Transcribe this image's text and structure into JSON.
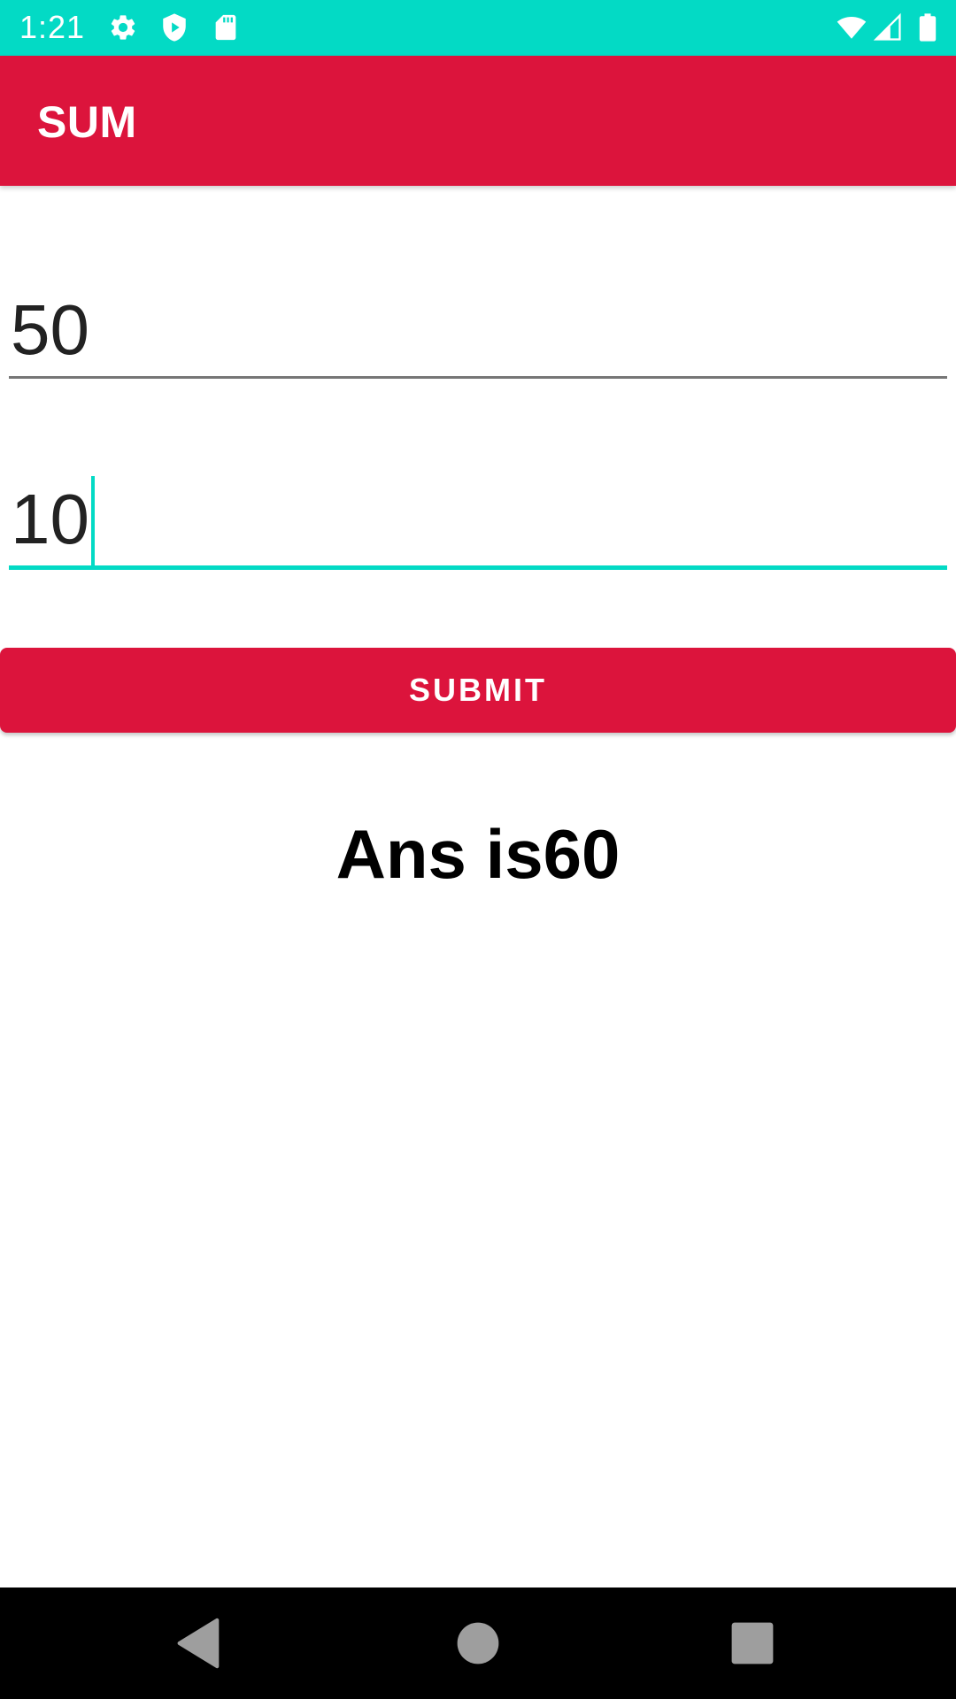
{
  "status_bar": {
    "time": "1:21",
    "left_icons": [
      "gear-icon",
      "shield-icon",
      "sd-card-icon"
    ],
    "right_icons": [
      "wifi-icon",
      "cellular-signal-icon",
      "battery-icon"
    ],
    "color": "#03DAC5"
  },
  "app_bar": {
    "title": "SUM",
    "color": "#DC143C"
  },
  "inputs": {
    "first_value": "50",
    "second_value": "10"
  },
  "submit": {
    "label": "SUBMIT"
  },
  "result": {
    "text": "Ans is60"
  },
  "nav_bar": {
    "buttons": [
      "back-icon",
      "home-icon",
      "recents-icon"
    ]
  }
}
